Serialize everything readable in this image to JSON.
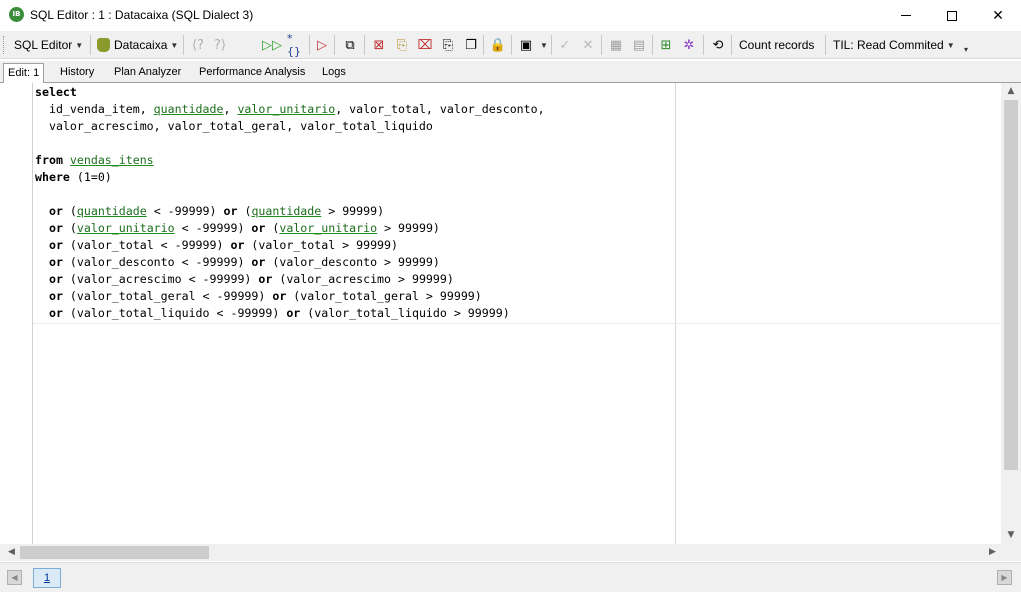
{
  "window": {
    "title": "SQL Editor : 1 : Datacaixa (SQL Dialect 3)",
    "app_icon_text": "IB"
  },
  "toolbar": {
    "sql_editor_label": "SQL Editor",
    "database_label": "Datacaixa",
    "count_records_label": "Count records",
    "til_label": "TIL: Read Commited",
    "icons": [
      "prev-query-icon",
      "next-query-icon",
      "run-icon",
      "run-step-icon",
      "format-code-icon",
      "stop-icon",
      "copy-grid-icon",
      "new-icon",
      "paste-icon",
      "delete-icon",
      "copy-icon",
      "clipboard-icon",
      "lock-icon",
      "toggle-icon",
      "commit-icon",
      "rollback-icon",
      "grid-icon",
      "grid2-icon",
      "tree-icon",
      "settings-icon",
      "refresh-icon"
    ]
  },
  "tabs": [
    {
      "label": "Edit: 1",
      "active": true
    },
    {
      "label": "History",
      "active": false
    },
    {
      "label": "Plan Analyzer",
      "active": false
    },
    {
      "label": "Performance Analysis",
      "active": false
    },
    {
      "label": "Logs",
      "active": false
    }
  ],
  "code_lines": [
    [
      {
        "t": "select",
        "c": "kw"
      }
    ],
    [
      {
        "t": "  id_venda_item, "
      },
      {
        "t": "quantidade",
        "c": "ident"
      },
      {
        "t": ", "
      },
      {
        "t": "valor_unitario",
        "c": "ident"
      },
      {
        "t": ", valor_total, valor_desconto,"
      }
    ],
    [
      {
        "t": "  valor_acrescimo, valor_total_geral, valor_total_liquido"
      }
    ],
    [
      {
        "t": ""
      }
    ],
    [
      {
        "t": "from",
        "c": "kw"
      },
      {
        "t": " "
      },
      {
        "t": "vendas_itens",
        "c": "ident"
      }
    ],
    [
      {
        "t": "where",
        "c": "kw"
      },
      {
        "t": " (1=0)"
      }
    ],
    [
      {
        "t": ""
      }
    ],
    [
      {
        "t": "  "
      },
      {
        "t": "or",
        "c": "kw"
      },
      {
        "t": " ("
      },
      {
        "t": "quantidade",
        "c": "ident"
      },
      {
        "t": " < -99999) "
      },
      {
        "t": "or",
        "c": "kw"
      },
      {
        "t": " ("
      },
      {
        "t": "quantidade",
        "c": "ident"
      },
      {
        "t": " > 99999)"
      }
    ],
    [
      {
        "t": "  "
      },
      {
        "t": "or",
        "c": "kw"
      },
      {
        "t": " ("
      },
      {
        "t": "valor_unitario",
        "c": "ident"
      },
      {
        "t": " < -99999) "
      },
      {
        "t": "or",
        "c": "kw"
      },
      {
        "t": " ("
      },
      {
        "t": "valor_unitario",
        "c": "ident"
      },
      {
        "t": " > 99999)"
      }
    ],
    [
      {
        "t": "  "
      },
      {
        "t": "or",
        "c": "kw"
      },
      {
        "t": " (valor_total < -99999) "
      },
      {
        "t": "or",
        "c": "kw"
      },
      {
        "t": " (valor_total > 99999)"
      }
    ],
    [
      {
        "t": "  "
      },
      {
        "t": "or",
        "c": "kw"
      },
      {
        "t": " (valor_desconto < -99999) "
      },
      {
        "t": "or",
        "c": "kw"
      },
      {
        "t": " (valor_desconto > 99999)"
      }
    ],
    [
      {
        "t": "  "
      },
      {
        "t": "or",
        "c": "kw"
      },
      {
        "t": " (valor_acrescimo < -99999) "
      },
      {
        "t": "or",
        "c": "kw"
      },
      {
        "t": " (valor_acrescimo > 99999)"
      }
    ],
    [
      {
        "t": "  "
      },
      {
        "t": "or",
        "c": "kw"
      },
      {
        "t": " (valor_total_geral < -99999) "
      },
      {
        "t": "or",
        "c": "kw"
      },
      {
        "t": " (valor_total_geral > 99999)"
      }
    ],
    [
      {
        "t": "  "
      },
      {
        "t": "or",
        "c": "kw"
      },
      {
        "t": " (valor_total_liquido < -99999) "
      },
      {
        "t": "or",
        "c": "kw"
      },
      {
        "t": " (valor_total_liquido > 99999)"
      }
    ]
  ],
  "pagination": {
    "current_page": "1"
  },
  "colors": {
    "highlight": "#e8141c",
    "identifier": "#1e6e1e",
    "run_green": "#2ca02c"
  }
}
